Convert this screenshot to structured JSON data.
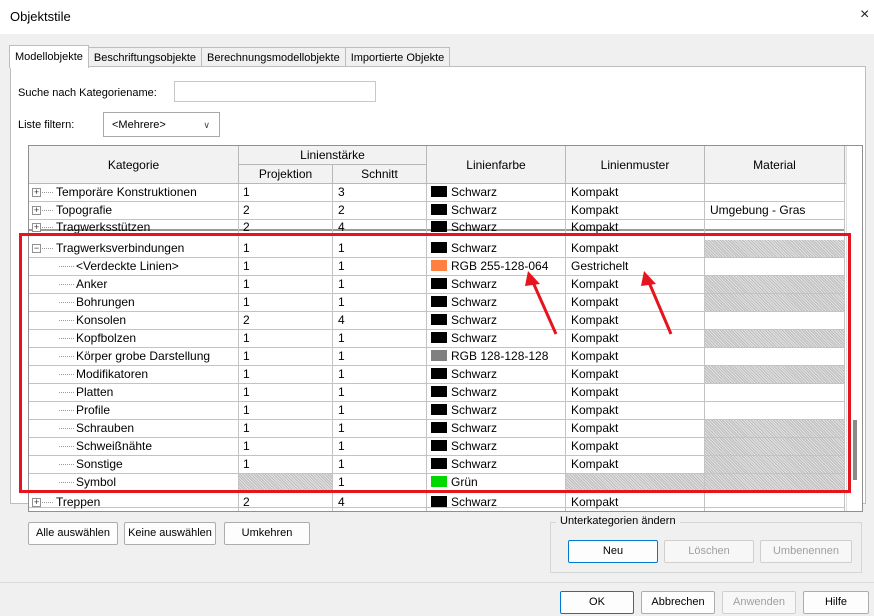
{
  "window": {
    "title": "Objektstile",
    "close_glyph": "×"
  },
  "tabs": [
    {
      "label": "Modellobjekte",
      "active": true
    },
    {
      "label": "Beschriftungsobjekte",
      "active": false
    },
    {
      "label": "Berechnungsmodellobjekte",
      "active": false
    },
    {
      "label": "Importierte Objekte",
      "active": false
    }
  ],
  "search": {
    "label": "Suche nach Kategoriename:",
    "value": ""
  },
  "filter": {
    "label": "Liste filtern:",
    "value": "<Mehrere>"
  },
  "table": {
    "headers": {
      "kategorie": "Kategorie",
      "linienstaerke": "Linienstärke",
      "projektion": "Projektion",
      "schnitt": "Schnitt",
      "linienfarbe": "Linienfarbe",
      "linienmuster": "Linienmuster",
      "material": "Material"
    },
    "rows": [
      {
        "name": "Temporäre Konstruktionen",
        "level": 0,
        "expander": "+",
        "proj": "1",
        "schnitt": "3",
        "farbe": "Schwarz",
        "farbe_hex": "#000000",
        "muster": "Kompakt",
        "material": "",
        "mat_hatch": false,
        "proj_hatch": false
      },
      {
        "name": "Topografie",
        "level": 0,
        "expander": "+",
        "proj": "2",
        "schnitt": "2",
        "farbe": "Schwarz",
        "farbe_hex": "#000000",
        "muster": "Kompakt",
        "material": "Umgebung - Gras",
        "mat_hatch": false,
        "proj_hatch": false
      },
      {
        "name": "Tragwerksstützen",
        "level": 0,
        "expander": "+",
        "proj": "2",
        "schnitt": "4",
        "farbe": "Schwarz",
        "farbe_hex": "#000000",
        "muster": "Kompakt",
        "material": "",
        "mat_hatch": false,
        "proj_hatch": false,
        "partial": true
      },
      {
        "name": "Tragwerksverbindungen",
        "level": 0,
        "expander": "−",
        "proj": "1",
        "schnitt": "1",
        "farbe": "Schwarz",
        "farbe_hex": "#000000",
        "muster": "Kompakt",
        "material": "",
        "mat_hatch": true,
        "proj_hatch": false
      },
      {
        "name": "<Verdeckte Linien>",
        "level": 1,
        "proj": "1",
        "schnitt": "1",
        "farbe": "RGB 255-128-064",
        "farbe_hex": "#ff8040",
        "muster": "Gestrichelt",
        "material": "",
        "mat_hatch": false,
        "proj_hatch": false
      },
      {
        "name": "Anker",
        "level": 1,
        "proj": "1",
        "schnitt": "1",
        "farbe": "Schwarz",
        "farbe_hex": "#000000",
        "muster": "Kompakt",
        "material": "",
        "mat_hatch": true,
        "proj_hatch": false
      },
      {
        "name": "Bohrungen",
        "level": 1,
        "proj": "1",
        "schnitt": "1",
        "farbe": "Schwarz",
        "farbe_hex": "#000000",
        "muster": "Kompakt",
        "material": "",
        "mat_hatch": true,
        "proj_hatch": false
      },
      {
        "name": "Konsolen",
        "level": 1,
        "proj": "2",
        "schnitt": "4",
        "farbe": "Schwarz",
        "farbe_hex": "#000000",
        "muster": "Kompakt",
        "material": "",
        "mat_hatch": false,
        "proj_hatch": false
      },
      {
        "name": "Kopfbolzen",
        "level": 1,
        "proj": "1",
        "schnitt": "1",
        "farbe": "Schwarz",
        "farbe_hex": "#000000",
        "muster": "Kompakt",
        "material": "",
        "mat_hatch": true,
        "proj_hatch": false
      },
      {
        "name": "Körper grobe Darstellung",
        "level": 1,
        "proj": "1",
        "schnitt": "1",
        "farbe": "RGB 128-128-128",
        "farbe_hex": "#808080",
        "muster": "Kompakt",
        "material": "",
        "mat_hatch": false,
        "proj_hatch": false
      },
      {
        "name": "Modifikatoren",
        "level": 1,
        "proj": "1",
        "schnitt": "1",
        "farbe": "Schwarz",
        "farbe_hex": "#000000",
        "muster": "Kompakt",
        "material": "",
        "mat_hatch": true,
        "proj_hatch": false
      },
      {
        "name": "Platten",
        "level": 1,
        "proj": "1",
        "schnitt": "1",
        "farbe": "Schwarz",
        "farbe_hex": "#000000",
        "muster": "Kompakt",
        "material": "",
        "mat_hatch": false,
        "proj_hatch": false
      },
      {
        "name": "Profile",
        "level": 1,
        "proj": "1",
        "schnitt": "1",
        "farbe": "Schwarz",
        "farbe_hex": "#000000",
        "muster": "Kompakt",
        "material": "",
        "mat_hatch": false,
        "proj_hatch": false
      },
      {
        "name": "Schrauben",
        "level": 1,
        "proj": "1",
        "schnitt": "1",
        "farbe": "Schwarz",
        "farbe_hex": "#000000",
        "muster": "Kompakt",
        "material": "",
        "mat_hatch": true,
        "proj_hatch": false
      },
      {
        "name": "Schweißnähte",
        "level": 1,
        "proj": "1",
        "schnitt": "1",
        "farbe": "Schwarz",
        "farbe_hex": "#000000",
        "muster": "Kompakt",
        "material": "",
        "mat_hatch": true,
        "proj_hatch": false
      },
      {
        "name": "Sonstige",
        "level": 1,
        "proj": "1",
        "schnitt": "1",
        "farbe": "Schwarz",
        "farbe_hex": "#000000",
        "muster": "Kompakt",
        "material": "",
        "mat_hatch": true,
        "proj_hatch": false
      },
      {
        "name": "Symbol",
        "level": 1,
        "proj": "",
        "schnitt": "1",
        "farbe": "Grün",
        "farbe_hex": "#00d800",
        "muster": "",
        "material": "",
        "mat_hatch": true,
        "proj_hatch": true,
        "muster_hatch": true
      },
      {
        "name": "Treppen",
        "level": 0,
        "expander": "+",
        "proj": "2",
        "schnitt": "4",
        "farbe": "Schwarz",
        "farbe_hex": "#000000",
        "muster": "Kompakt",
        "material": "",
        "mat_hatch": false,
        "proj_hatch": false,
        "partial": true
      }
    ]
  },
  "buttons": {
    "alle": "Alle auswählen",
    "keine": "Keine auswählen",
    "umkehren": "Umkehren",
    "neu": "Neu",
    "loeschen": "Löschen",
    "umbenennen": "Umbenennen",
    "ok": "OK",
    "abbrechen": "Abbrechen",
    "anwenden": "Anwenden",
    "hilfe": "Hilfe"
  },
  "subcategories": {
    "label": "Unterkategorien ändern"
  },
  "colors": {
    "highlight": "#e5141d",
    "primary_border": "#0078d4"
  }
}
